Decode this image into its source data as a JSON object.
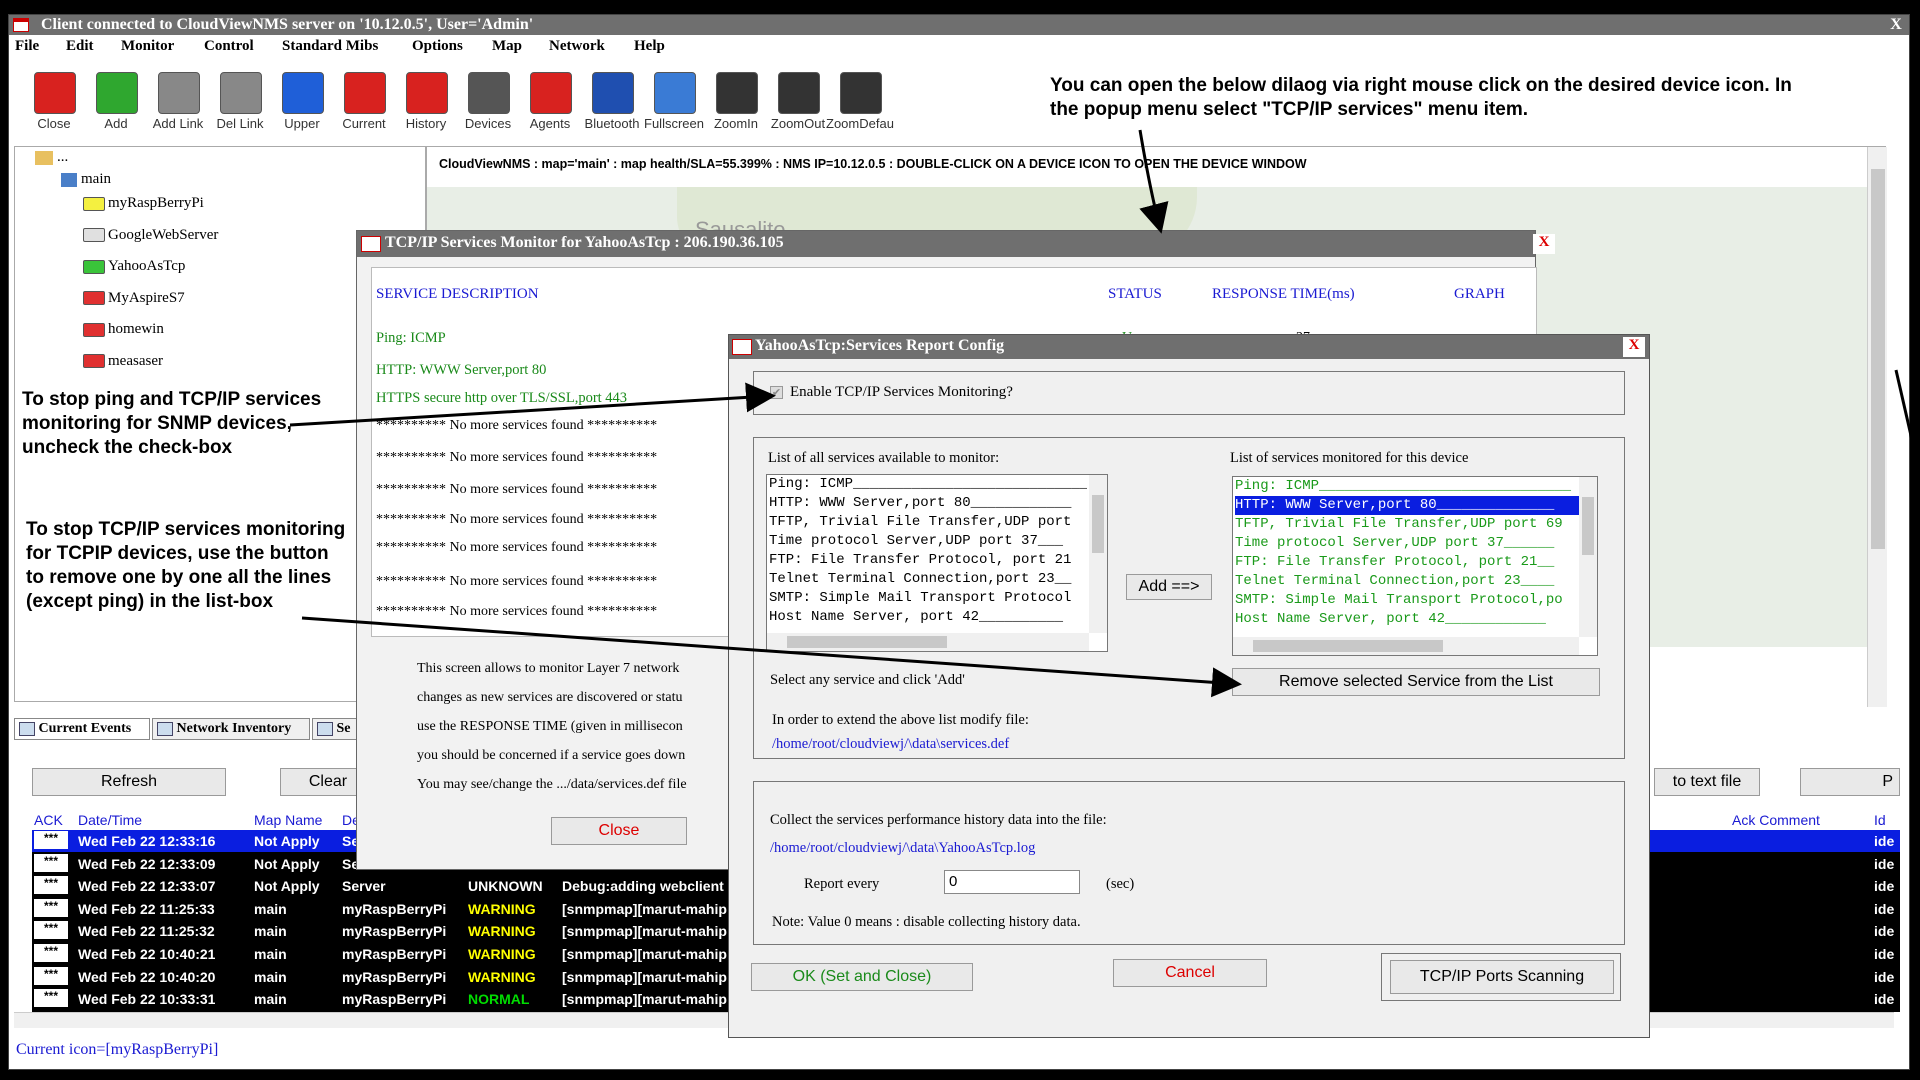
{
  "window": {
    "title": "Client connected to CloudViewNMS server on '10.12.0.5', User='Admin'",
    "close": "X"
  },
  "menu": [
    "File",
    "Edit",
    "Monitor",
    "Control",
    "Standard Mibs",
    "Options",
    "Map",
    "Network",
    "Help"
  ],
  "toolbar": [
    {
      "label": "Close",
      "icon": "close-icon",
      "color": "#d8221f"
    },
    {
      "label": "Add",
      "icon": "plus-icon",
      "color": "#2fa72f"
    },
    {
      "label": "Add Link",
      "icon": "add-link-icon",
      "color": "#888888"
    },
    {
      "label": "Del Link",
      "icon": "del-link-icon",
      "color": "#888888"
    },
    {
      "label": "Upper",
      "icon": "arrow-up-icon",
      "color": "#1f5fd8"
    },
    {
      "label": "Current",
      "icon": "current-icon",
      "color": "#d8221f"
    },
    {
      "label": "History",
      "icon": "history-icon",
      "color": "#d8221f"
    },
    {
      "label": "Devices",
      "icon": "devices-icon",
      "color": "#555555"
    },
    {
      "label": "Agents",
      "icon": "agent-icon",
      "color": "#d8221f"
    },
    {
      "label": "Bluetooth",
      "icon": "bluetooth-icon",
      "color": "#1f4fb0"
    },
    {
      "label": "Fullscreen",
      "icon": "fullscreen-icon",
      "color": "#3a7bd5"
    },
    {
      "label": "ZoomIn",
      "icon": "zoom-in-icon",
      "color": "#333333"
    },
    {
      "label": "ZoomOut",
      "icon": "zoom-out-icon",
      "color": "#333333"
    },
    {
      "label": "ZoomDefault",
      "icon": "zoom-default-icon",
      "color": "#333333"
    }
  ],
  "top_annotation": "You can open the below dilaog via right mouse click on  the  desired device icon. In the popup menu select \"TCP/IP services\" menu item.",
  "tree": {
    "root": "...",
    "main": "main",
    "items": [
      {
        "name": "myRaspBerryPi",
        "color": "#f4f040"
      },
      {
        "name": "GoogleWebServer",
        "color": "#e0e0e0"
      },
      {
        "name": "YahooAsTcp",
        "color": "#3ac43a"
      },
      {
        "name": "MyAspireS7",
        "color": "#e03030"
      },
      {
        "name": "homewin",
        "color": "#e03030"
      },
      {
        "name": "measaser",
        "color": "#e03030"
      }
    ]
  },
  "map": {
    "status": "CloudViewNMS : map='main' : map health/SLA=55.399% : NMS  IP=10.12.0.5 : DOUBLE-CLICK ON A DEVICE ICON TO OPEN THE DEVICE WINDOW",
    "place": "Sausalito"
  },
  "annotations": {
    "ping": "To stop ping and TCP/IP services monitoring for SNMP devices, uncheck the check-box",
    "tcpip": "To stop TCP/IP services monitoring for TCPIP devices, use the button to remove one by one all the lines (except ping) in the list-box"
  },
  "bottom": {
    "tabs": [
      "Current Events",
      "Network Inventory",
      "Se"
    ],
    "refresh": "Refresh",
    "clear": "Clear",
    "totext": "to text file",
    "right_btn": "P",
    "headers": {
      "ack": "ACK",
      "date": "Date/Time",
      "map": "Map Name",
      "dev": "Dev",
      "ackc": "Ack Comment",
      "id": "Id"
    },
    "rows": [
      {
        "ack": "***",
        "date": "Wed Feb 22 12:33:16",
        "map": "Not Apply",
        "dev": "Serv",
        "status": "",
        "msg": "",
        "id": "ide",
        "selected": true
      },
      {
        "ack": "***",
        "date": "Wed Feb 22 12:33:09",
        "map": "Not Apply",
        "dev": "Serv",
        "status": "",
        "msg": "",
        "id": "ide"
      },
      {
        "ack": "***",
        "date": "Wed Feb 22 12:33:07",
        "map": "Not Apply",
        "dev": "Server",
        "status": "UNKNOWN",
        "msg": "Debug:adding webclient r",
        "id": "ide"
      },
      {
        "ack": "***",
        "date": "Wed Feb 22 11:25:33",
        "map": "main",
        "dev": "myRaspBerryPi",
        "status": "WARNING",
        "msg": "[snmpmap][marut-mahip",
        "id": "ide"
      },
      {
        "ack": "***",
        "date": "Wed Feb 22 11:25:32",
        "map": "main",
        "dev": "myRaspBerryPi",
        "status": "WARNING",
        "msg": "[snmpmap][marut-mahip",
        "id": "ide"
      },
      {
        "ack": "***",
        "date": "Wed Feb 22 10:40:21",
        "map": "main",
        "dev": "myRaspBerryPi",
        "status": "WARNING",
        "msg": "[snmpmap][marut-mahip",
        "id": "ide"
      },
      {
        "ack": "***",
        "date": "Wed Feb 22 10:40:20",
        "map": "main",
        "dev": "myRaspBerryPi",
        "status": "WARNING",
        "msg": "[snmpmap][marut-mahip",
        "id": "ide"
      },
      {
        "ack": "***",
        "date": "Wed Feb 22 10:33:31",
        "map": "main",
        "dev": "myRaspBerryPi",
        "status": "NORMAL",
        "msg": "[snmpmap][marut-mahip",
        "id": "ide"
      }
    ],
    "status_colors": {
      "UNKNOWN": "#ffffff",
      "WARNING": "#ffff00",
      "NORMAL": "#00dd00"
    },
    "current_icon": "Current icon=[myRaspBerryPi]"
  },
  "monitor": {
    "title": "TCP/IP Services Monitor for YahooAsTcp : 206.190.36.105",
    "close_x": "X",
    "col_desc": "SERVICE DESCRIPTION",
    "col_status": "STATUS",
    "col_resp": "RESPONSE TIME(ms)",
    "col_graph": "GRAPH",
    "services": [
      "Ping: ICMP",
      "HTTP: WWW Server,port 80",
      "HTTPS secure http over TLS/SSL,port 443"
    ],
    "none_found": "********** No more services found **********",
    "partial_status": "U",
    "partial_resp": "27",
    "info": [
      "This screen allows to monitor Layer 7 network",
      "changes as new services are discovered or statu",
      "use the RESPONSE TIME (given in millisecon",
      "you should be concerned if a service goes down",
      "You may see/change the .../data/services.def file"
    ],
    "close": "Close"
  },
  "config": {
    "title": "YahooAsTcp:Services Report Config",
    "close_x": "X",
    "enable_label": "Enable TCP/IP Services Monitoring?",
    "list_all_label": "List of all services available to monitor:",
    "list_mon_label": "List of services monitored for this device",
    "all_services": [
      "Ping: ICMP______________________________",
      "HTTP: WWW Server,port 80____________",
      "TFTP, Trivial File Transfer,UDP port",
      "Time protocol Server,UDP port 37___",
      "FTP: File Transfer Protocol, port 21",
      "Telnet Terminal Connection,port 23__",
      "SMTP: Simple Mail Transport Protocol",
      "Host Name Server, port 42__________"
    ],
    "mon_services": [
      "Ping: ICMP______________________________",
      "HTTP: WWW Server,port 80______________",
      "TFTP, Trivial File Transfer,UDP port 69",
      "Time protocol Server,UDP port 37______",
      "FTP: File Transfer Protocol, port 21__",
      "Telnet Terminal Connection,port 23____",
      "SMTP: Simple Mail Transport Protocol,po",
      "Host Name Server, port 42____________"
    ],
    "add": "Add ==>",
    "select_hint": "Select any service and click 'Add'",
    "remove": "Remove selected Service from the List",
    "extend_hint": "In order to extend the above list modify file:",
    "services_path": "/home/root/cloudviewj/\\data\\services.def",
    "collect_label": "Collect the services performance history data into the file:",
    "log_path": "/home/root/cloudviewj/\\data\\YahooAsTcp.log",
    "report_every": "Report every",
    "report_value": "0",
    "sec": "(sec)",
    "note": "Note: Value 0 means : disable collecting history data.",
    "ok": "OK (Set and Close)",
    "cancel": "Cancel",
    "scan": "TCP/IP Ports Scanning"
  }
}
